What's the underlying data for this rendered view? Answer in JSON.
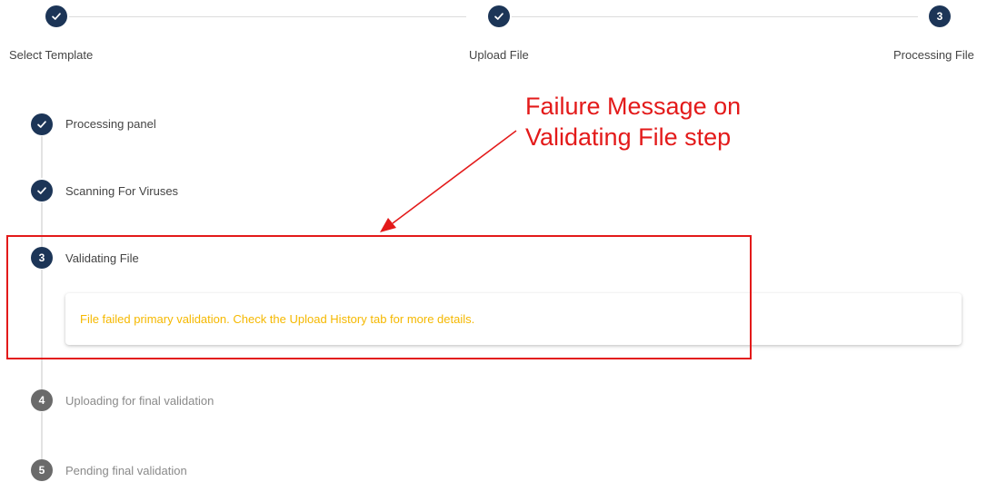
{
  "stepper": {
    "steps": [
      {
        "label": "Select Template",
        "state": "complete",
        "icon": "check-icon"
      },
      {
        "label": "Upload File",
        "state": "complete",
        "icon": "check-icon"
      },
      {
        "label": "Processing File",
        "state": "active",
        "number": "3"
      }
    ]
  },
  "processing": {
    "steps": [
      {
        "label": "Processing panel",
        "state": "complete",
        "icon": "check-icon"
      },
      {
        "label": "Scanning For Viruses",
        "state": "complete",
        "icon": "check-icon"
      },
      {
        "label": "Validating File",
        "state": "active",
        "number": "3"
      },
      {
        "label": "Uploading for final validation",
        "state": "pending",
        "number": "4"
      },
      {
        "label": "Pending final validation",
        "state": "pending",
        "number": "5"
      }
    ],
    "message": "File failed primary validation. Check the Upload History tab for more details."
  },
  "annotation": {
    "line1": "Failure Message on",
    "line2": "Validating File step"
  },
  "colors": {
    "complete": "#1c3557",
    "pending": "#6a6a6a",
    "warning_text": "#f5b800",
    "annotation": "#e31a1a"
  }
}
